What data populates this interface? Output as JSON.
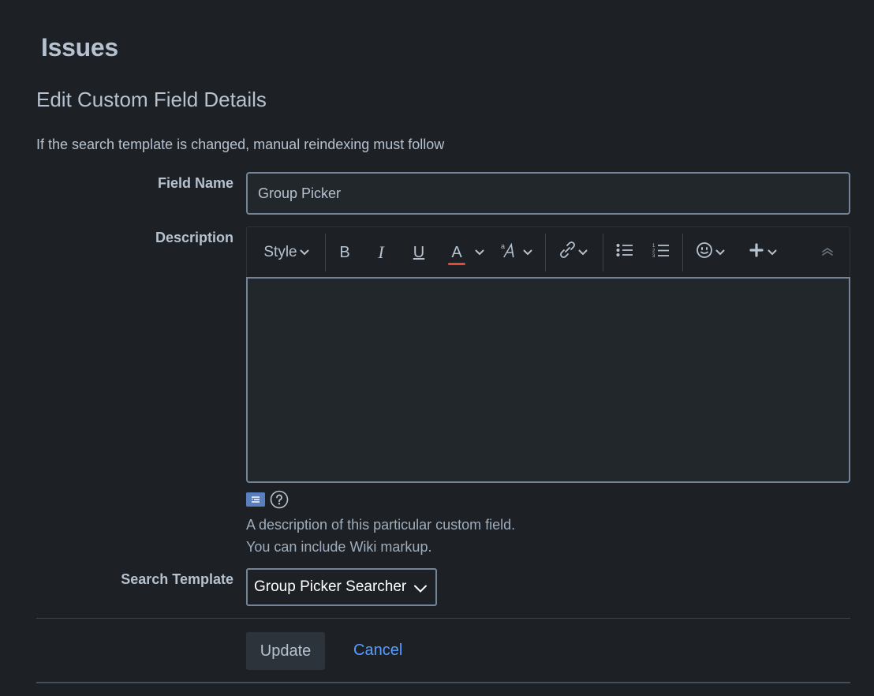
{
  "page": {
    "title": "Issues",
    "section_title": "Edit Custom Field Details",
    "notice": "If the search template is changed, manual reindexing must follow"
  },
  "form": {
    "field_name": {
      "label": "Field Name",
      "value": "Group Picker"
    },
    "description": {
      "label": "Description",
      "value": "",
      "help_lines": [
        "A description of this particular custom field.",
        "You can include Wiki markup."
      ]
    },
    "search_template": {
      "label": "Search Template",
      "selected": "Group Picker Searcher"
    }
  },
  "toolbar": {
    "style_label": "Style",
    "bold_label": "B",
    "italic_label": "I",
    "underline_label": "U",
    "text_color_label": "A",
    "text_color_underline": "#e34935",
    "icons": [
      "chevron-down-icon",
      "text-effects-icon",
      "link-icon",
      "bullet-list-icon",
      "numbered-list-icon",
      "emoji-icon",
      "plus-icon",
      "collapse-icon",
      "wiki-markup-icon",
      "help-icon"
    ]
  },
  "actions": {
    "update_label": "Update",
    "cancel_label": "Cancel"
  },
  "colors": {
    "background": "#1d2125",
    "text": "#b6c2cf",
    "link": "#579dff",
    "input_border": "#738496"
  }
}
